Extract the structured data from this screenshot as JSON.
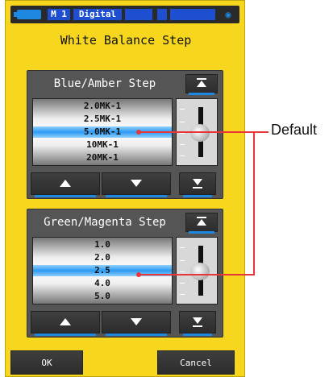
{
  "status_bar": {
    "memory": "M 1",
    "mode": "Digital",
    "icons": [
      "battery-icon",
      "meter-icon",
      "lock-icon"
    ],
    "accent_color": "#1e87e0"
  },
  "title": "White Balance Step",
  "blue_amber": {
    "heading": "Blue/Amber Step",
    "options": [
      "2.0MK-1",
      "2.5MK-1",
      "5.0MK-1",
      "10MK-1",
      "20MK-1"
    ],
    "selected_index": 2
  },
  "green_magenta": {
    "heading": "Green/Magenta Step",
    "options": [
      "1.0",
      "2.0",
      "2.5",
      "4.0",
      "5.0"
    ],
    "selected_index": 2
  },
  "buttons": {
    "ok": "OK",
    "cancel": "Cancel"
  },
  "annotation": {
    "label": "Default",
    "color": "#e8353a"
  },
  "selection_color": "#2c9af2"
}
